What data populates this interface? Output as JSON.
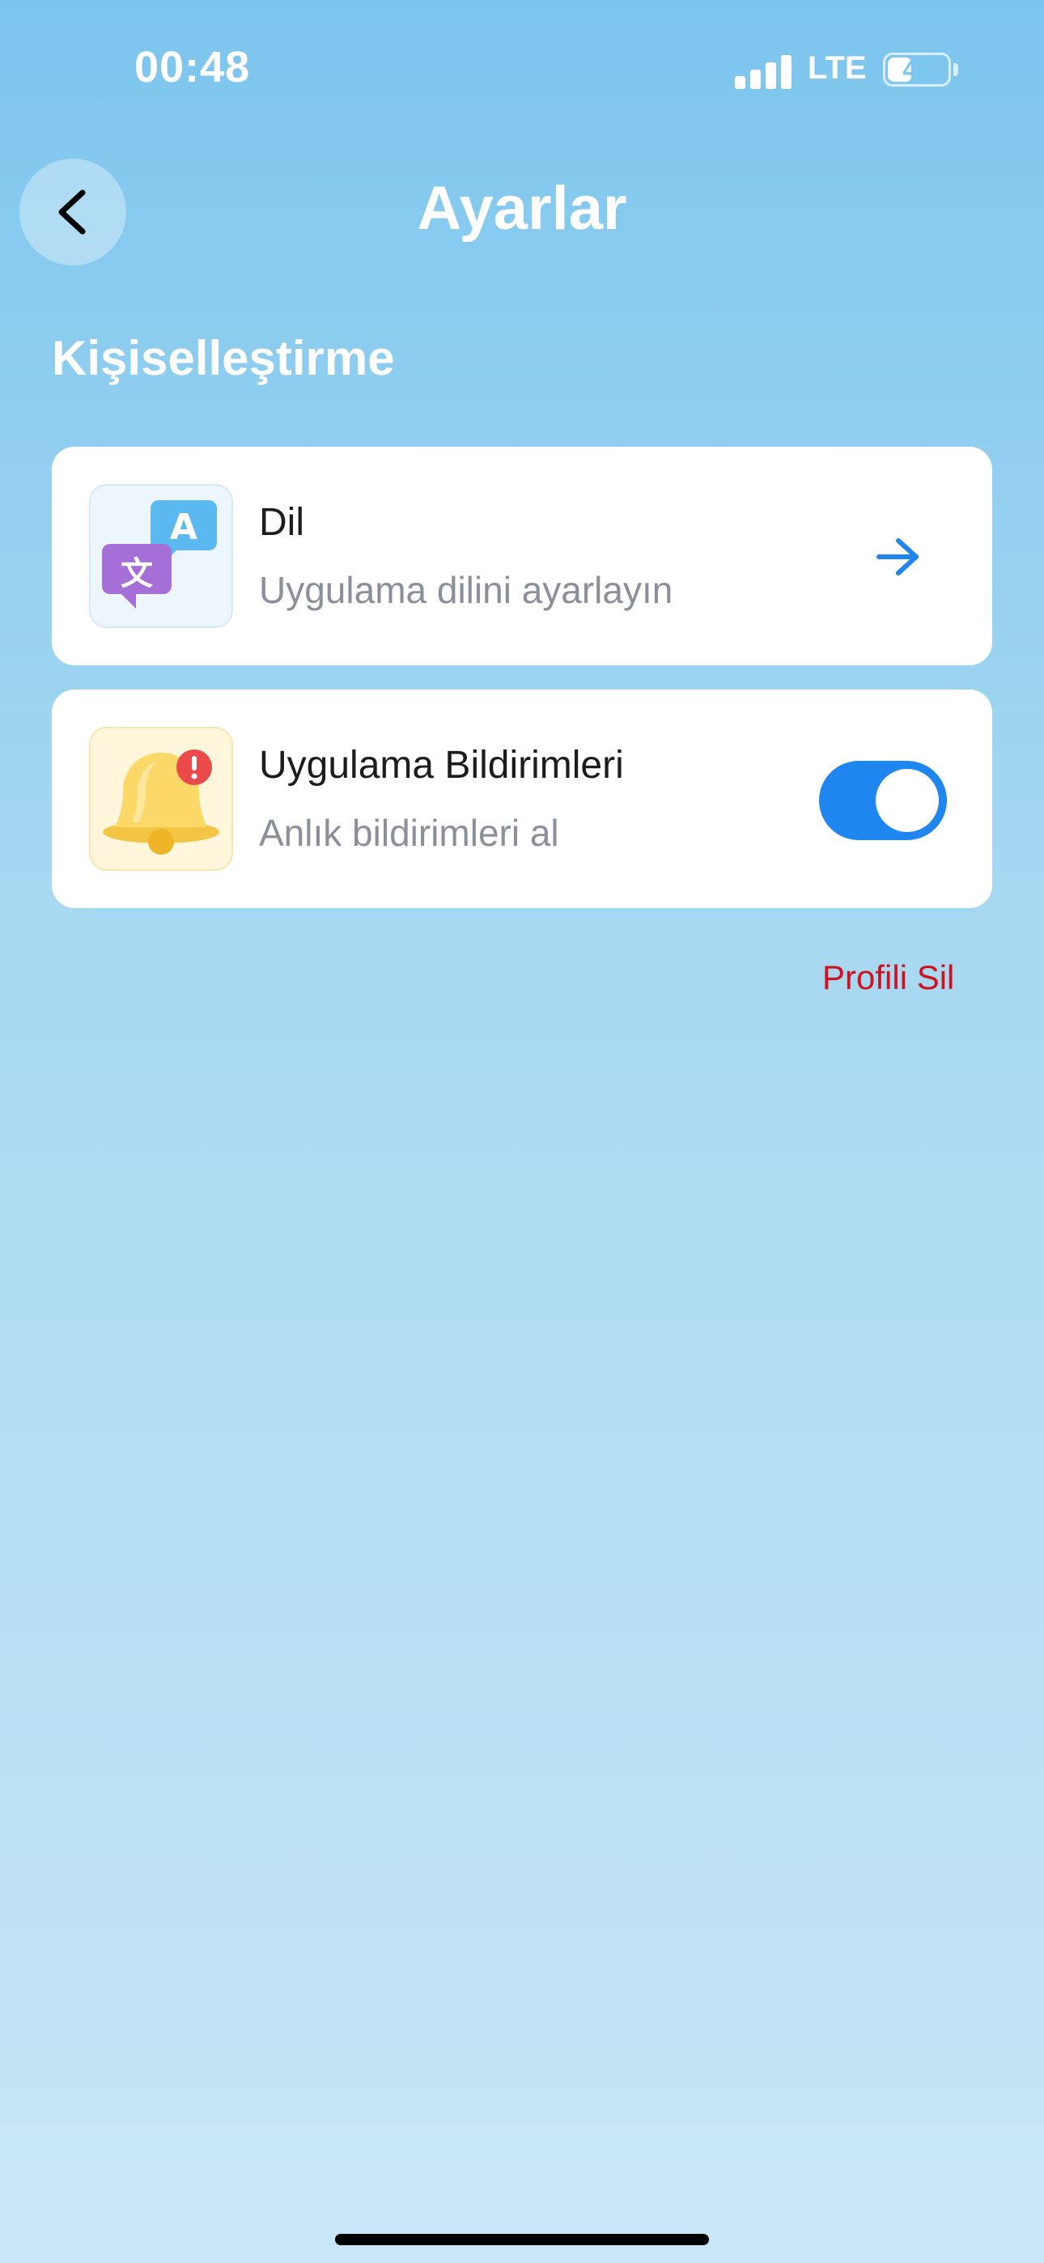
{
  "status_bar": {
    "time": "00:48",
    "network": "LTE",
    "battery": "40"
  },
  "header": {
    "title": "Ayarlar",
    "back_icon": "chevron-left-icon"
  },
  "section": {
    "title": "Kişiselleştirme"
  },
  "settings": {
    "language": {
      "title": "Dil",
      "subtitle": "Uygulama dilini ayarlayın",
      "icon": "language-translate-icon",
      "action_icon": "arrow-right-icon"
    },
    "notifications": {
      "title": "Uygulama Bildirimleri",
      "subtitle": "Anlık bildirimleri al",
      "icon": "bell-alert-icon",
      "enabled": true
    }
  },
  "delete_profile": {
    "label": "Profili Sil"
  },
  "colors": {
    "accent": "#1f86f0",
    "danger": "#d0101d",
    "bg_top": "#7cc5ee",
    "bg_bottom": "#c9e6f7"
  }
}
